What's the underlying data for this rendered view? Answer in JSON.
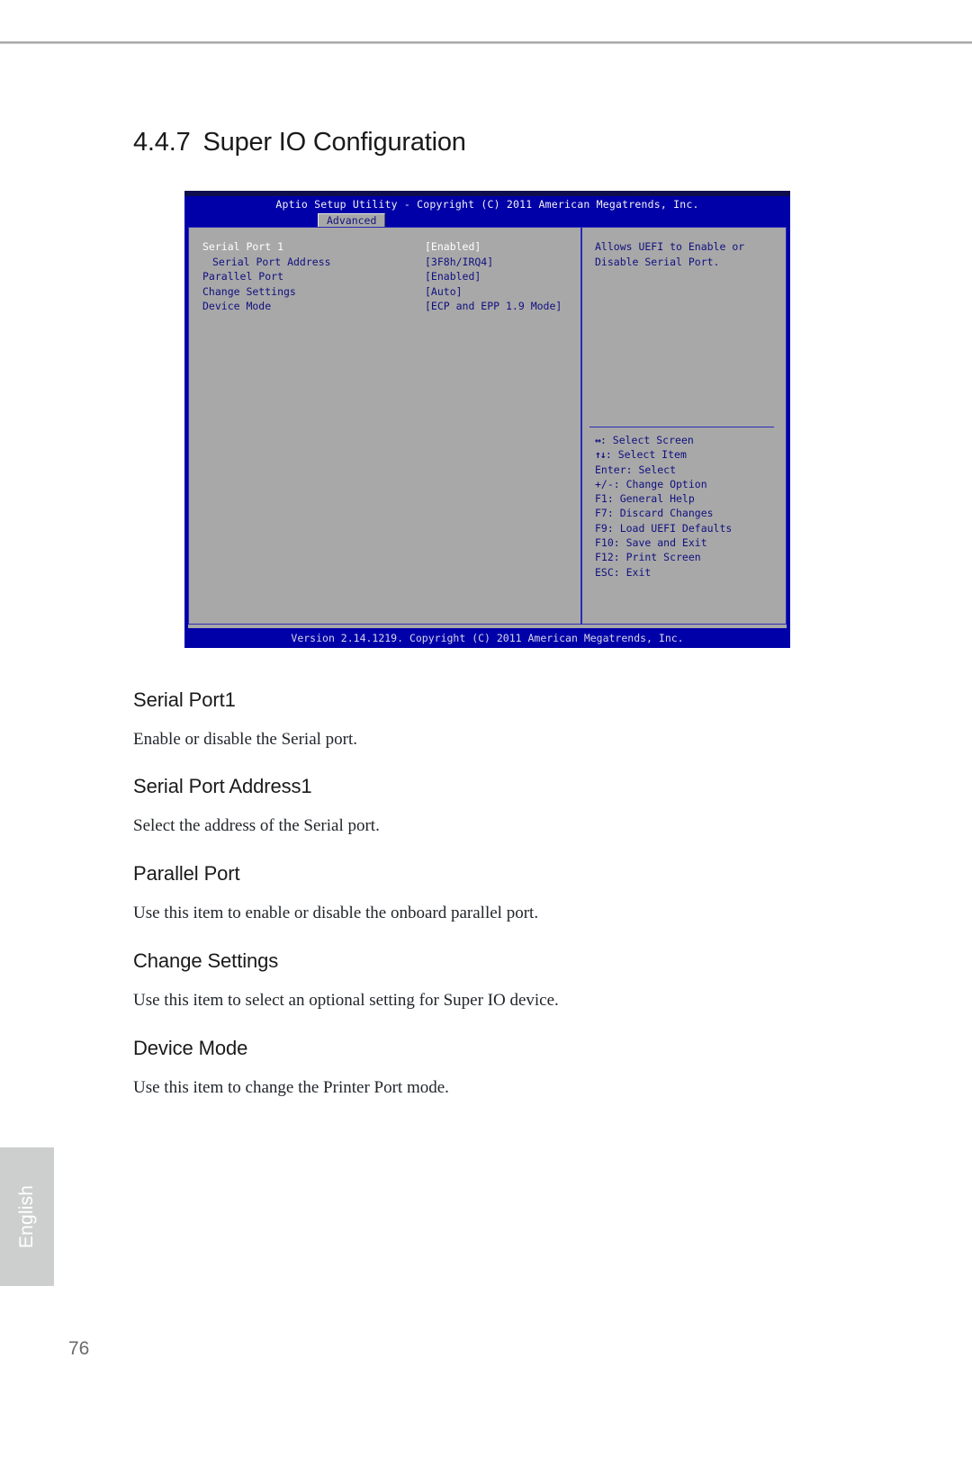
{
  "page": {
    "section_number": "4.4.7",
    "section_title": "Super IO Configuration",
    "page_number": "76",
    "language_tab": "English"
  },
  "bios": {
    "title_bar": "Aptio Setup Utility - Copyright (C) 2011 American Megatrends, Inc.",
    "active_tab": "Advanced",
    "footer": "Version 2.14.1219. Copyright (C) 2011 American Megatrends, Inc.",
    "options": [
      {
        "label": "Serial Port 1",
        "value": "[Enabled]",
        "indent": false,
        "highlighted": true
      },
      {
        "label": "Serial Port Address",
        "value": "[3F8h/IRQ4]",
        "indent": true,
        "highlighted": false
      },
      {
        "label": "Parallel Port",
        "value": "[Enabled]",
        "indent": false,
        "highlighted": false
      },
      {
        "label": "Change Settings",
        "value": "[Auto]",
        "indent": false,
        "highlighted": false
      },
      {
        "label": "Device Mode",
        "value": "[ECP and EPP 1.9 Mode]",
        "indent": false,
        "highlighted": false
      }
    ],
    "help_lines": [
      "Allows UEFI to Enable or",
      "Disable Serial Port."
    ],
    "key_hints": [
      {
        "glyph": "↔",
        "text": ": Select Screen"
      },
      {
        "glyph": "↑↓",
        "text": ": Select Item"
      },
      {
        "glyph": "",
        "text": "Enter: Select"
      },
      {
        "glyph": "",
        "text": "+/-: Change Option"
      },
      {
        "glyph": "",
        "text": "F1: General Help"
      },
      {
        "glyph": "",
        "text": "F7: Discard Changes"
      },
      {
        "glyph": "",
        "text": "F9: Load UEFI Defaults"
      },
      {
        "glyph": "",
        "text": "F10: Save and Exit"
      },
      {
        "glyph": "",
        "text": "F12: Print Screen"
      },
      {
        "glyph": "",
        "text": "ESC: Exit"
      }
    ]
  },
  "entries": [
    {
      "title": "Serial Port1",
      "desc": "Enable or disable the Serial port."
    },
    {
      "title": "Serial Port Address1",
      "desc": "Select the address of the Serial port."
    },
    {
      "title": "Parallel Port",
      "desc": "Use this item to enable or disable the onboard parallel port."
    },
    {
      "title": "Change Settings",
      "desc": "Use this item to select an optional setting for Super IO device."
    },
    {
      "title": "Device Mode",
      "desc": "Use this item to change the Printer Port mode."
    }
  ]
}
